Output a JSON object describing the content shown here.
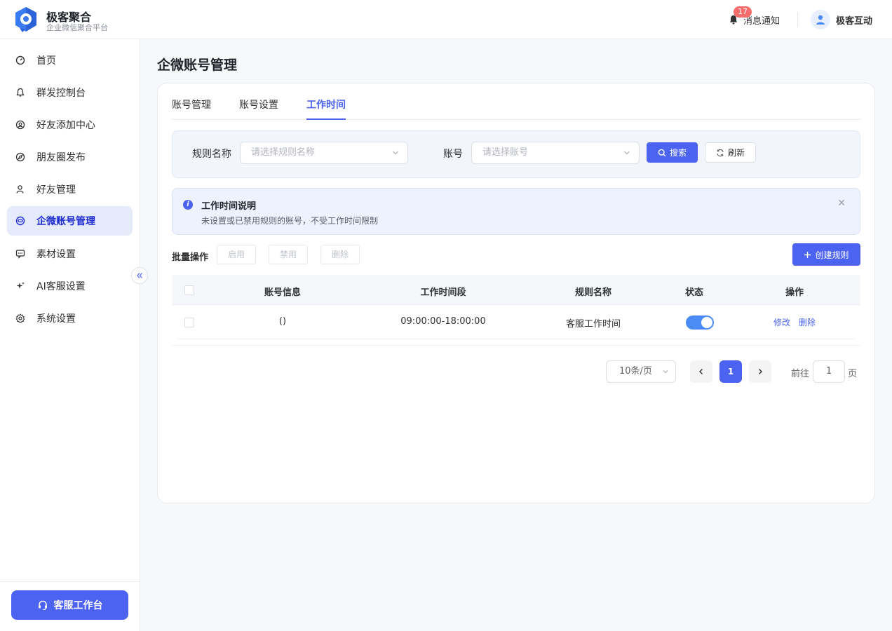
{
  "header": {
    "brand_title": "极客聚合",
    "brand_subtitle": "企业微信聚合平台",
    "notify_label": "消息通知",
    "notify_count": "17",
    "user_name": "极客互动"
  },
  "sidebar": {
    "items": [
      {
        "label": "首页",
        "icon": "dashboard-icon"
      },
      {
        "label": "群发控制台",
        "icon": "bell-icon"
      },
      {
        "label": "好友添加中心",
        "icon": "user-add-icon"
      },
      {
        "label": "朋友圈发布",
        "icon": "compass-icon"
      },
      {
        "label": "好友管理",
        "icon": "user-icon"
      },
      {
        "label": "企微账号管理",
        "icon": "account-icon",
        "active": true
      },
      {
        "label": "素材设置",
        "icon": "message-icon"
      },
      {
        "label": "AI客服设置",
        "icon": "sparkle-icon"
      },
      {
        "label": "系统设置",
        "icon": "gear-icon"
      }
    ],
    "service_button": "客服工作台"
  },
  "main": {
    "title": "企微账号管理",
    "tabs": [
      {
        "label": "账号管理"
      },
      {
        "label": "账号设置"
      },
      {
        "label": "工作时间",
        "active": true
      }
    ],
    "filter": {
      "rule_label": "规则名称",
      "rule_placeholder": "请选择规则名称",
      "account_label": "账号",
      "account_placeholder": "请选择账号",
      "search_label": "搜索",
      "refresh_label": "刷新"
    },
    "alert": {
      "title": "工作时间说明",
      "desc": "未设置或已禁用规则的账号，不受工作时间限制"
    },
    "batch": {
      "label": "批量操作",
      "enable": "启用",
      "disable": "禁用",
      "delete": "删除",
      "create": "创建规则"
    },
    "table": {
      "columns": [
        "账号信息",
        "工作时间段",
        "规则名称",
        "状态",
        "操作"
      ],
      "rows": [
        {
          "account": "()",
          "period": "09:00:00-18:00:00",
          "rule": "客服工作时间",
          "enabled": true,
          "edit": "修改",
          "delete": "删除"
        }
      ]
    },
    "pagination": {
      "page_size": "10条/页",
      "current": "1",
      "goto_label": "前往",
      "goto_value": "1",
      "page_suffix": "页"
    }
  },
  "colors": {
    "primary": "#4b63f0",
    "badge": "#f56c6c",
    "switch_on": "#4b8bf5"
  }
}
